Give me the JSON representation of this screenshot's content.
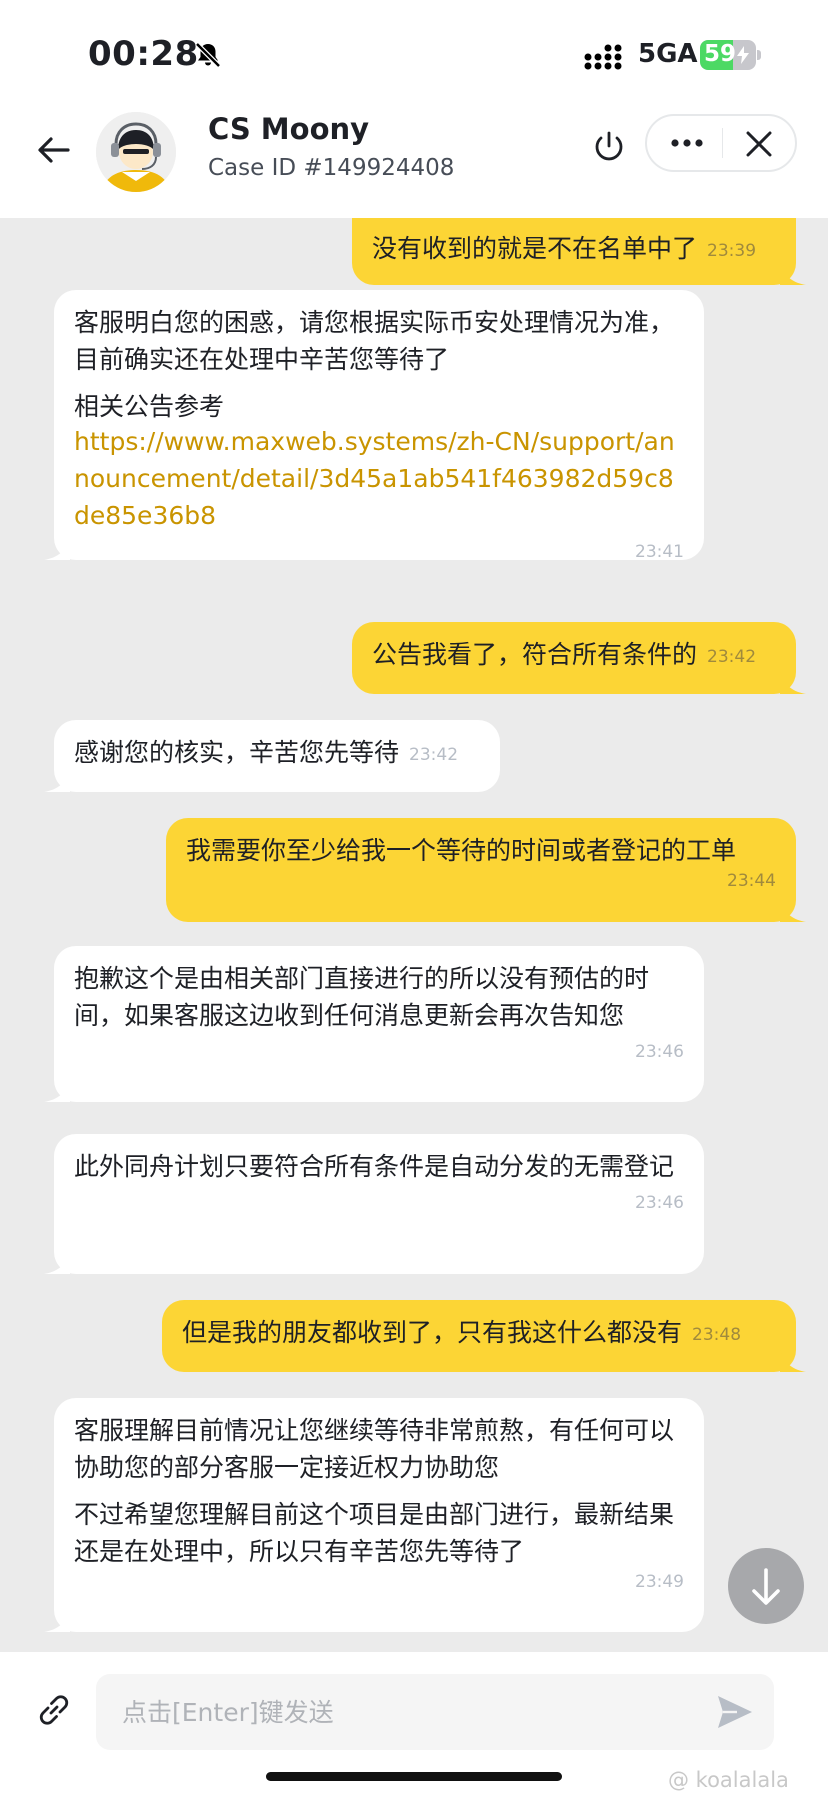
{
  "status_bar": {
    "time": "00:28",
    "network": "5GA",
    "battery": "59",
    "battery_level": 0.59,
    "icons": [
      "bell-slash-icon",
      "signal-icon",
      "battery-charging-icon"
    ]
  },
  "header": {
    "agent_name": "CS Moony",
    "case_id": "Case ID #149924408",
    "icons": [
      "back-arrow-icon",
      "power-icon",
      "more-icon",
      "close-icon"
    ]
  },
  "messages": [
    {
      "dir": "out",
      "paragraphs": [
        "没有收到的就是不在名单中了"
      ],
      "time": "23:39"
    },
    {
      "dir": "in",
      "paragraphs": [
        "客服明白您的困惑，请您根据实际币安处理情况为准，目前确实还在处理中辛苦您等待了",
        "相关公告参考"
      ],
      "link": "https://www.maxweb.systems/zh-CN/support/announcement/detail/3d45a1ab541f463982d59c8de85e36b8",
      "time": "23:41"
    },
    {
      "dir": "out",
      "paragraphs": [
        "公告我看了，符合所有条件的"
      ],
      "time": "23:42"
    },
    {
      "dir": "in",
      "paragraphs": [
        "感谢您的核实，辛苦您先等待"
      ],
      "time": "23:42"
    },
    {
      "dir": "out",
      "paragraphs": [
        "我需要你至少给我一个等待的时间或者登记的工单"
      ],
      "time": "23:44"
    },
    {
      "dir": "in",
      "paragraphs": [
        "抱歉这个是由相关部门直接进行的所以没有预估的时间，如果客服这边收到任何消息更新会再次告知您"
      ],
      "time": "23:46"
    },
    {
      "dir": "in",
      "paragraphs": [
        "此外同舟计划只要符合所有条件是自动分发的无需登记"
      ],
      "time": "23:46"
    },
    {
      "dir": "out",
      "paragraphs": [
        "但是我的朋友都收到了，只有我这什么都没有"
      ],
      "time": "23:48"
    },
    {
      "dir": "in",
      "paragraphs": [
        "客服理解目前情况让您继续等待非常煎熬，有任何可以协助您的部分客服一定接近权力协助您",
        "不过希望您理解目前这个项目是由部门进行，最新结果还是在处理中，所以只有辛苦您先等待了"
      ],
      "time": "23:49"
    }
  ],
  "composer": {
    "placeholder": "点击[Enter]键发送",
    "value": "",
    "icons": [
      "attach-link-icon",
      "send-icon"
    ]
  },
  "watermark": "@ koalalala",
  "colors": {
    "accent": "#fcd535",
    "chat_bg": "#ebebeb",
    "link": "#c99400"
  }
}
